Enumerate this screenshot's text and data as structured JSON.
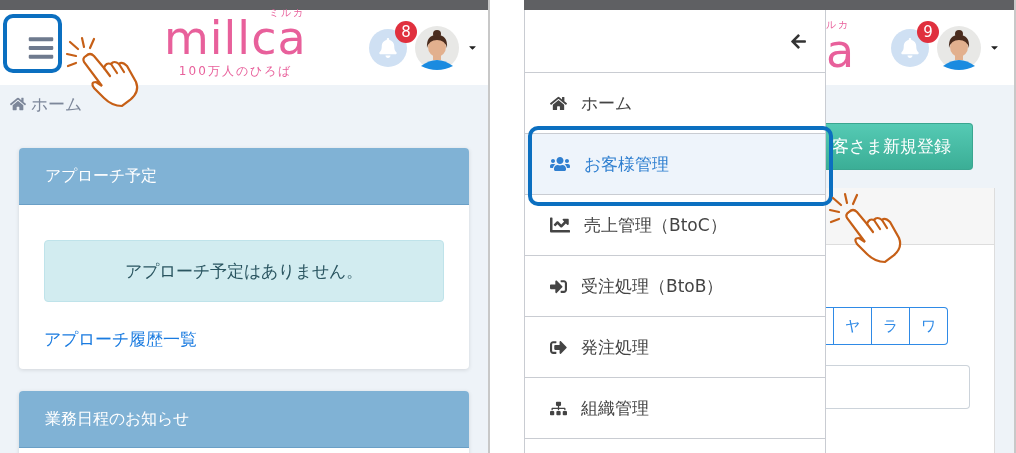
{
  "left_screen": {
    "header": {
      "logo": "millca",
      "logo_kana": "ミルカ",
      "tagline": "100万人のひろば",
      "notification_count": "8"
    },
    "breadcrumb": "ホーム",
    "cards": [
      {
        "title": "アプローチ予定",
        "alert": "アプローチ予定はありません。",
        "link": "アプローチ履歴一覧"
      },
      {
        "title": "業務日程のお知らせ"
      }
    ]
  },
  "right_screen": {
    "header": {
      "logo": "a",
      "logo_kana": "ルカ",
      "notification_count": "9"
    },
    "drawer": {
      "items": [
        {
          "label": "ホーム",
          "kind": "home",
          "selected": false
        },
        {
          "label": "お客様管理",
          "kind": "users",
          "selected": true
        },
        {
          "label": "売上管理（BtoC）",
          "kind": "chart",
          "selected": false
        },
        {
          "label": "受注処理（BtoB）",
          "kind": "sign-in",
          "selected": false
        },
        {
          "label": "発注処理",
          "kind": "sign-out",
          "selected": false
        },
        {
          "label": "組織管理",
          "kind": "sitemap",
          "selected": false
        }
      ]
    },
    "register_button": "客さま新規登録",
    "kana_buttons": [
      "ヤ",
      "ラ",
      "ワ"
    ]
  }
}
